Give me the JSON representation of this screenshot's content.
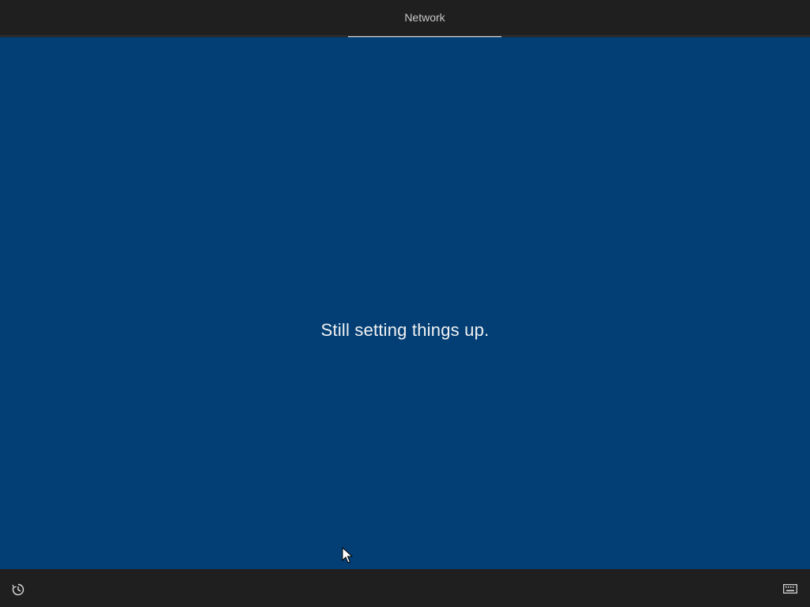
{
  "header": {
    "steps": [
      {
        "label": "Network",
        "active": true
      }
    ]
  },
  "main": {
    "status_message": "Still setting things up."
  },
  "footer": {
    "left_icon": "ease-of-access-icon",
    "right_icon": "keyboard-icon"
  },
  "colors": {
    "background_blue": "#033f75",
    "bar_dark": "#1f1f1f",
    "text_light": "#f2f2f2",
    "active_underline": "#e6e6e6"
  }
}
